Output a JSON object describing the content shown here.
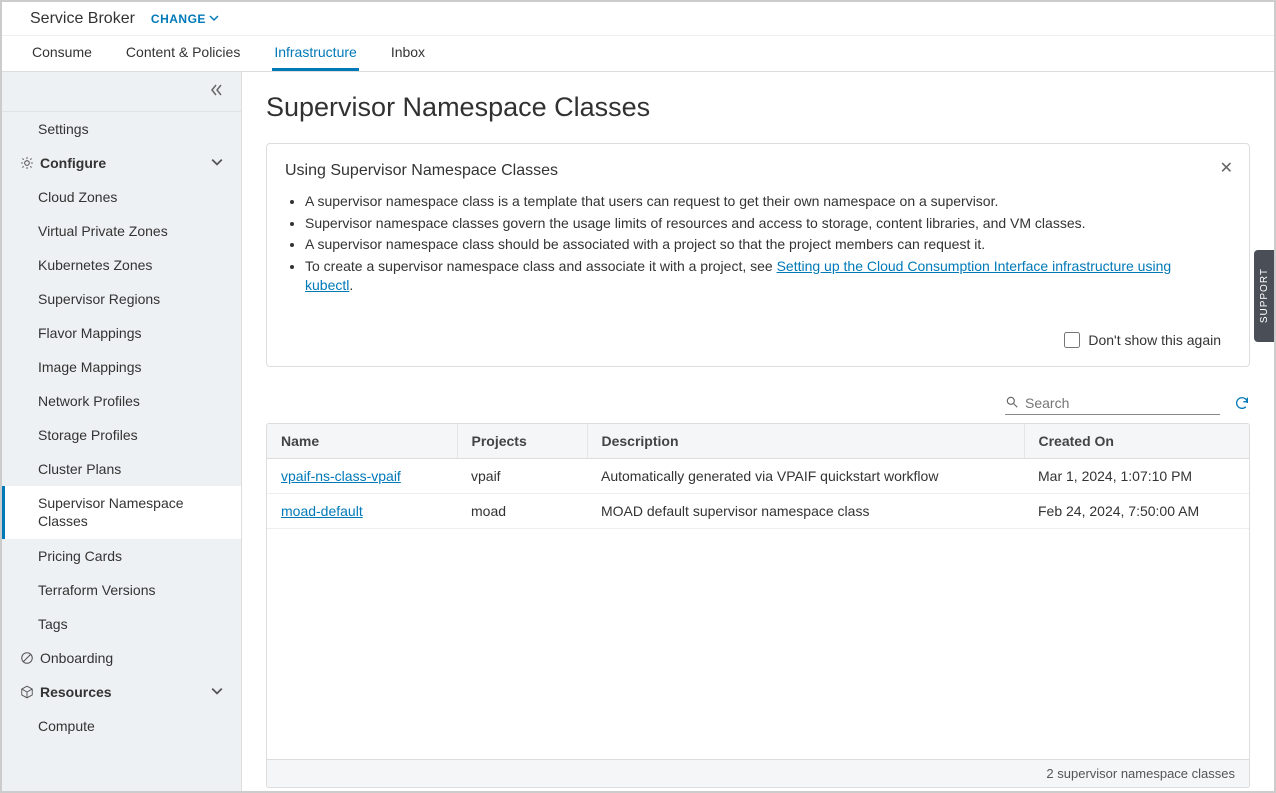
{
  "header": {
    "app_title": "Service Broker",
    "change_label": "CHANGE"
  },
  "tabs": [
    {
      "label": "Consume"
    },
    {
      "label": "Content & Policies"
    },
    {
      "label": "Infrastructure"
    },
    {
      "label": "Inbox"
    }
  ],
  "sidebar": {
    "items": [
      {
        "label": "Settings"
      }
    ],
    "configure_label": "Configure",
    "configure_items": [
      {
        "label": "Cloud Zones"
      },
      {
        "label": "Virtual Private Zones"
      },
      {
        "label": "Kubernetes Zones"
      },
      {
        "label": "Supervisor Regions"
      },
      {
        "label": "Flavor Mappings"
      },
      {
        "label": "Image Mappings"
      },
      {
        "label": "Network Profiles"
      },
      {
        "label": "Storage Profiles"
      },
      {
        "label": "Cluster Plans"
      },
      {
        "label": "Supervisor Namespace Classes"
      },
      {
        "label": "Pricing Cards"
      },
      {
        "label": "Terraform Versions"
      },
      {
        "label": "Tags"
      }
    ],
    "onboarding_label": "Onboarding",
    "resources_label": "Resources",
    "resources_items": [
      {
        "label": "Compute"
      }
    ]
  },
  "page": {
    "title": "Supervisor Namespace Classes",
    "info": {
      "heading": "Using Supervisor Namespace Classes",
      "bullets": [
        "A supervisor namespace class is a template that users can request to get their own namespace on a supervisor.",
        "Supervisor namespace classes govern the usage limits of resources and access to storage, content libraries, and VM classes.",
        "A supervisor namespace class should be associated with a project so that the project members can request it."
      ],
      "bullet4_prefix": "To create a supervisor namespace class and associate it with a project, see ",
      "bullet4_link": "Setting up the Cloud Consumption Interface infrastructure using kubectl",
      "bullet4_suffix": ".",
      "dont_show": "Don't show this again"
    },
    "search_placeholder": "Search",
    "table": {
      "headers": {
        "name": "Name",
        "projects": "Projects",
        "description": "Description",
        "created": "Created On"
      },
      "rows": [
        {
          "name": "vpaif-ns-class-vpaif",
          "projects": "vpaif",
          "description": "Automatically generated via VPAIF quickstart workflow",
          "created": "Mar 1, 2024, 1:07:10 PM"
        },
        {
          "name": "moad-default",
          "projects": "moad",
          "description": "MOAD default supervisor namespace class",
          "created": "Feb 24, 2024, 7:50:00 AM"
        }
      ],
      "footer": "2 supervisor namespace classes"
    }
  },
  "support_label": "SUPPORT"
}
